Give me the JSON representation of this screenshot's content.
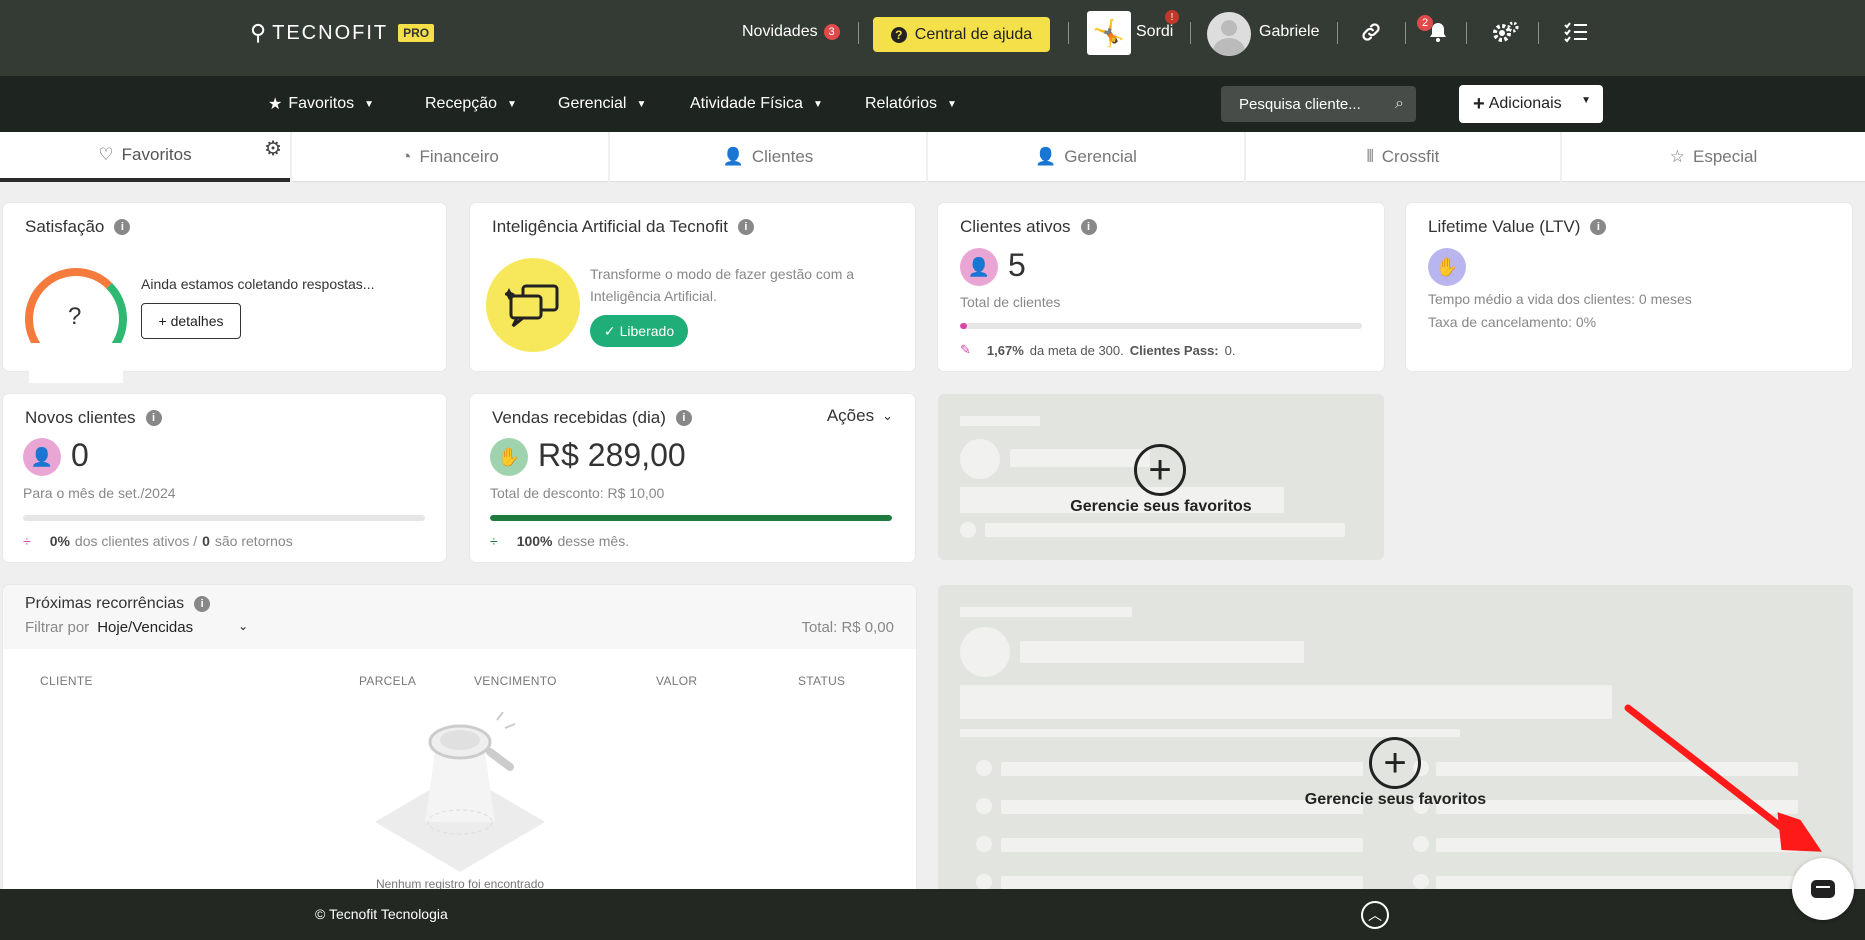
{
  "topbar": {
    "logo_text": "TECNOFIT",
    "logo_badge": "PRO",
    "news_label": "Novidades",
    "news_count": "3",
    "help_label": "Central de ajuda",
    "unit_name": "Sordi",
    "unit_alert": "!",
    "user_name": "Gabriele",
    "notification_count": "2"
  },
  "nav": {
    "items": [
      {
        "label": "Favoritos"
      },
      {
        "label": "Recepção"
      },
      {
        "label": "Gerencial"
      },
      {
        "label": "Atividade Física"
      },
      {
        "label": "Relatórios"
      }
    ],
    "search_placeholder": "Pesquisa cliente...",
    "add_label": "Adicionais"
  },
  "tabs": [
    {
      "label": "Favoritos"
    },
    {
      "label": "Financeiro"
    },
    {
      "label": "Clientes"
    },
    {
      "label": "Gerencial"
    },
    {
      "label": "Crossfit"
    },
    {
      "label": "Especial"
    }
  ],
  "satisfacao": {
    "title": "Satisfação",
    "gauge_value": "?",
    "message": "Ainda estamos coletando respostas...",
    "details_button": "+ detalhes"
  },
  "ia": {
    "title": "Inteligência Artificial da Tecnofit",
    "description": "Transforme o modo de fazer gestão com a Inteligência Artificial.",
    "badge": "Liberado"
  },
  "clientes_ativos": {
    "title": "Clientes ativos",
    "value": "5",
    "subtitle": "Total de clientes",
    "goal_percent": "1,67%",
    "goal_text": "da meta de 300.",
    "pass_label": "Clientes Pass:",
    "pass_value": "0.",
    "progress": 0.0167
  },
  "ltv": {
    "title": "Lifetime Value (LTV)",
    "line1": "Tempo médio a vida dos clientes: 0 meses",
    "line2": "Taxa de cancelamento: 0%"
  },
  "novos_clientes": {
    "title": "Novos clientes",
    "value": "0",
    "subtitle": "Para o mês de set./2024",
    "pct": "0%",
    "pct_text": "dos clientes ativos /",
    "returns": "0",
    "returns_text": "são retornos",
    "progress": 0
  },
  "vendas": {
    "title": "Vendas recebidas (dia)",
    "actions_label": "Ações",
    "value": "R$ 289,00",
    "discount": "Total de desconto: R$ 10,00",
    "pct": "100%",
    "pct_text": "desse mês.",
    "progress": 1.0
  },
  "favoritos_placeholder": {
    "label": "Gerencie seus favoritos"
  },
  "recorrencias": {
    "title": "Próximas recorrências",
    "filter_label": "Filtrar por",
    "filter_value": "Hoje/Vencidas",
    "total": "Total: R$ 0,00",
    "columns": [
      "CLIENTE",
      "PARCELA",
      "VENCIMENTO",
      "VALOR",
      "STATUS"
    ],
    "empty": "Nenhum registro foi encontrado"
  },
  "footer": {
    "copyright": "© Tecnofit Tecnologia"
  },
  "colors": {
    "topbar": "#343b35",
    "navbar": "#1e2420",
    "help_button": "#f4e048",
    "success": "#1fae78",
    "progress_green": "#1f7a3d",
    "pink": "#d946a6"
  }
}
